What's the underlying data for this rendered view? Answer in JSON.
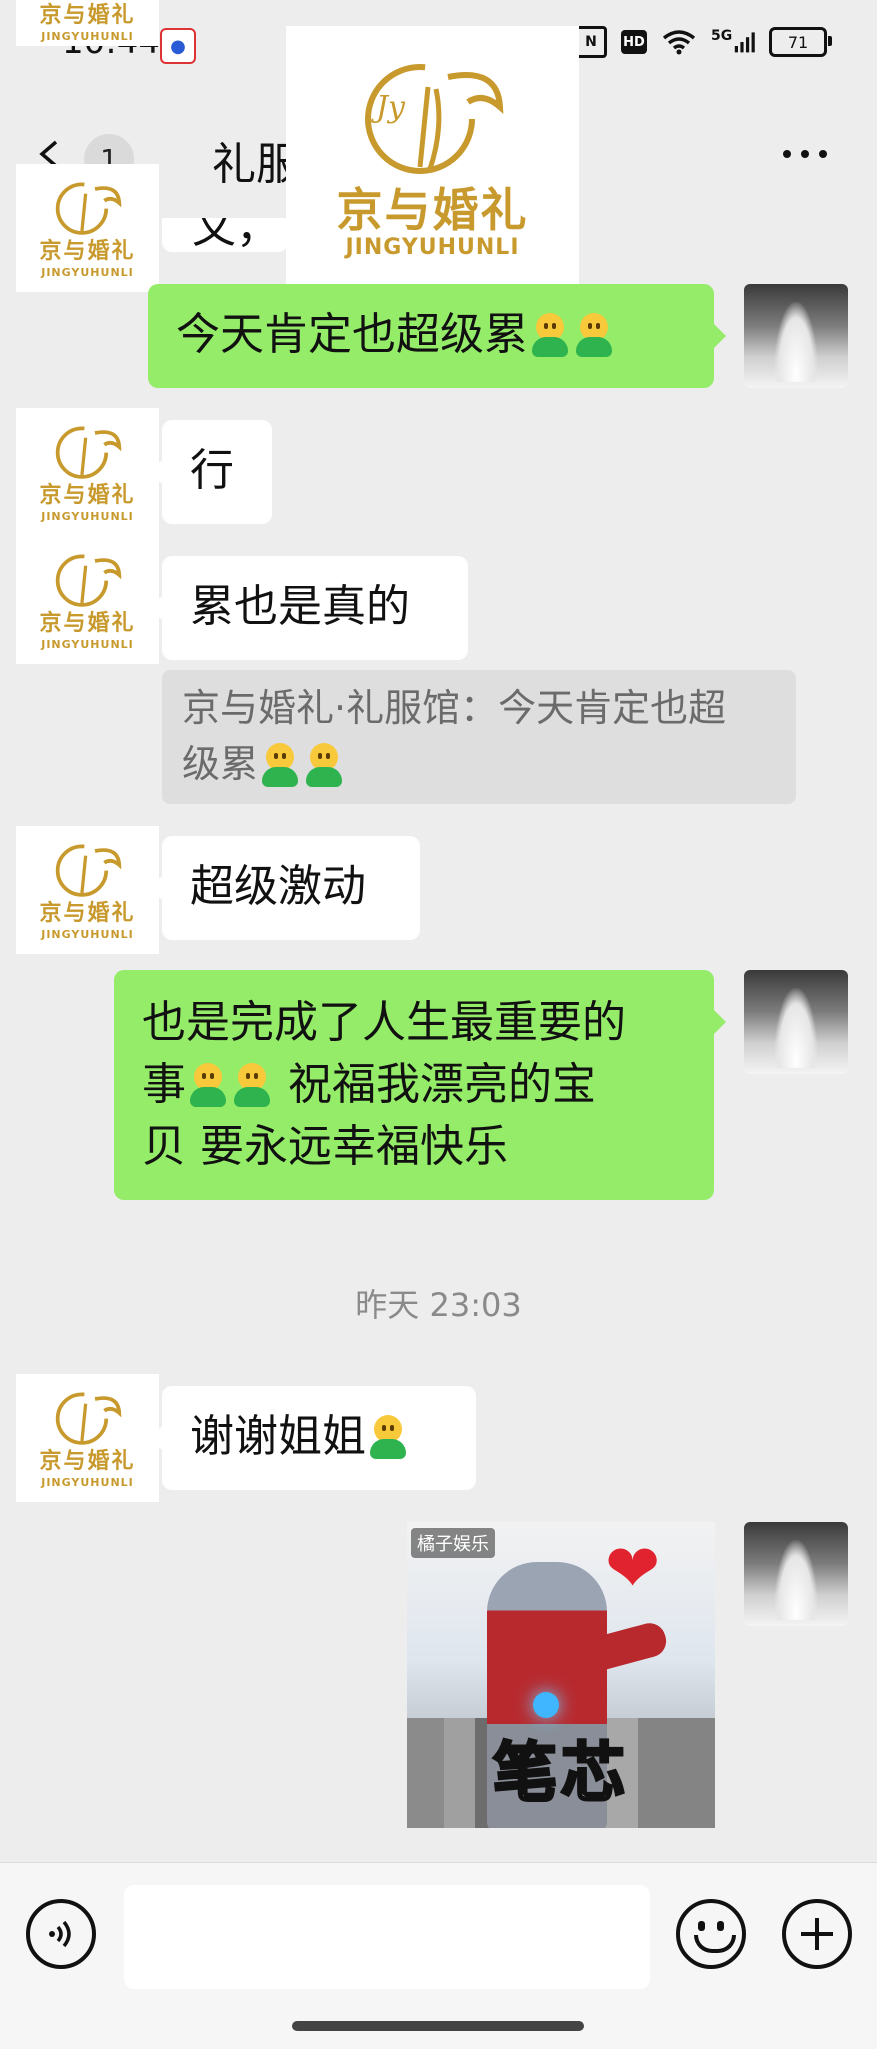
{
  "status_bar": {
    "time": "10:44",
    "battery": "71",
    "hd_label": "HD",
    "network_label": "5G",
    "icons": [
      "baidu-app-icon",
      "nfc-icon",
      "hd-icon",
      "wifi-icon",
      "signal-icon",
      "battery-icon"
    ]
  },
  "header": {
    "unread_count": "1",
    "title": "礼服                              月16",
    "back_icon": "chevron-left-icon",
    "more_icon": "more-dots-icon"
  },
  "brand": {
    "name_cn": "京与婚礼",
    "name_en": "JINGYUHUNLI",
    "monogram": "Jy",
    "color": "#c89a2e"
  },
  "messages": [
    {
      "id": "m0",
      "side": "in",
      "text": "文，"
    },
    {
      "id": "m1",
      "side": "out",
      "text": "今天肯定也超级累",
      "emoji_count": 2
    },
    {
      "id": "m2",
      "side": "in",
      "text": "行"
    },
    {
      "id": "m3",
      "side": "in",
      "text": "累也是真的"
    },
    {
      "id": "m4",
      "side": "quote",
      "text_a": "京与婚礼·礼服馆：今天肯定也超",
      "text_b": "级累",
      "emoji_count": 2
    },
    {
      "id": "m5",
      "side": "in",
      "text": "超级激动"
    },
    {
      "id": "m6",
      "side": "out",
      "line1": "也是完成了人生最重要的",
      "line2_a": "事",
      "line2_b": " 祝福我漂亮的宝",
      "line3": "贝 要永远幸福快乐",
      "emoji_count": 2
    },
    {
      "id": "m7",
      "side": "in",
      "text": "谢谢姐姐",
      "emoji_count": 1
    },
    {
      "id": "m8",
      "side": "out",
      "type": "sticker",
      "caption": "笔芯",
      "tag": "橘子娱乐"
    }
  ],
  "timestamp": "昨天 23:03",
  "input_bar": {
    "value": "",
    "placeholder": "",
    "voice_icon": "voice-icon",
    "emoji_icon": "smiley-icon",
    "plus_icon": "plus-icon"
  },
  "colors": {
    "background": "#ededed",
    "outgoing_bubble": "#95ec69",
    "incoming_bubble": "#ffffff",
    "quote_bg": "#dedede",
    "timestamp_text": "#8a8a8a"
  }
}
